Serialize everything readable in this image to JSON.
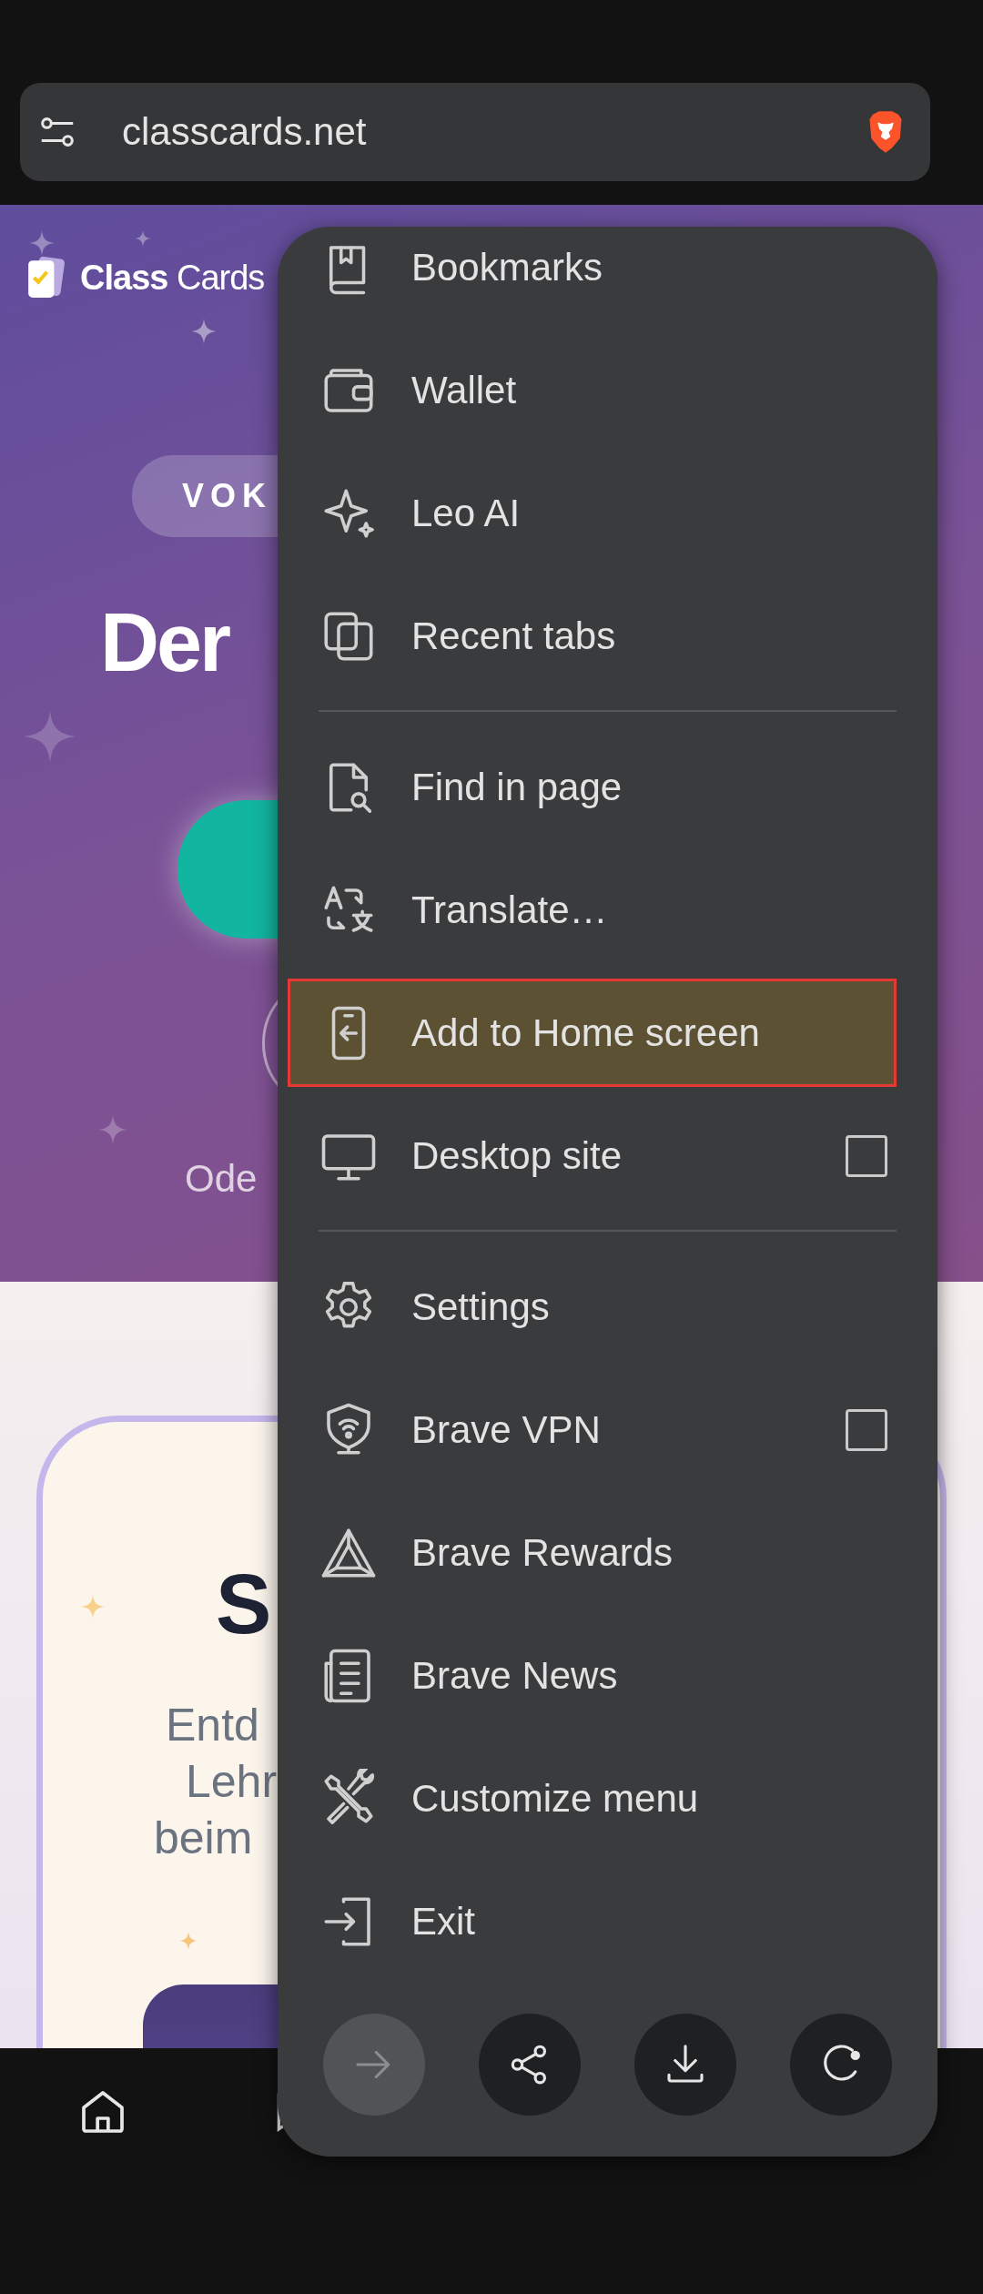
{
  "address_bar": {
    "url": "classcards.net"
  },
  "page": {
    "logo": "**Class** Cards",
    "tag": "VOK",
    "headline": "Der",
    "note": "Ode",
    "card": {
      "title": "S",
      "lines": [
        "Entd",
        "Lehr",
        "beim"
      ]
    }
  },
  "menu": {
    "sections": [
      [
        {
          "label": "Bookmarks",
          "selected": false
        },
        {
          "label": "Wallet",
          "selected": false
        },
        {
          "label": "Leo AI",
          "selected": false
        },
        {
          "label": "Recent tabs",
          "selected": false
        }
      ],
      [
        {
          "label": "Find in page",
          "selected": false
        },
        {
          "label": "Translate…",
          "selected": false
        },
        {
          "label": "Add to Home screen",
          "selected": true
        },
        {
          "label": "Desktop site",
          "selected": false,
          "checked": false
        }
      ],
      [
        {
          "label": "Settings",
          "selected": false
        },
        {
          "label": "Brave VPN",
          "selected": false,
          "checked": false
        },
        {
          "label": "Brave Rewards",
          "selected": false
        },
        {
          "label": "Brave News",
          "selected": false
        },
        {
          "label": "Customize menu",
          "selected": false
        },
        {
          "label": "Exit",
          "selected": false
        }
      ]
    ],
    "actions": [
      {
        "kind": "forward",
        "disabled": true
      },
      {
        "kind": "share",
        "disabled": false
      },
      {
        "kind": "download",
        "disabled": false
      },
      {
        "kind": "reload",
        "disabled": false
      }
    ]
  }
}
